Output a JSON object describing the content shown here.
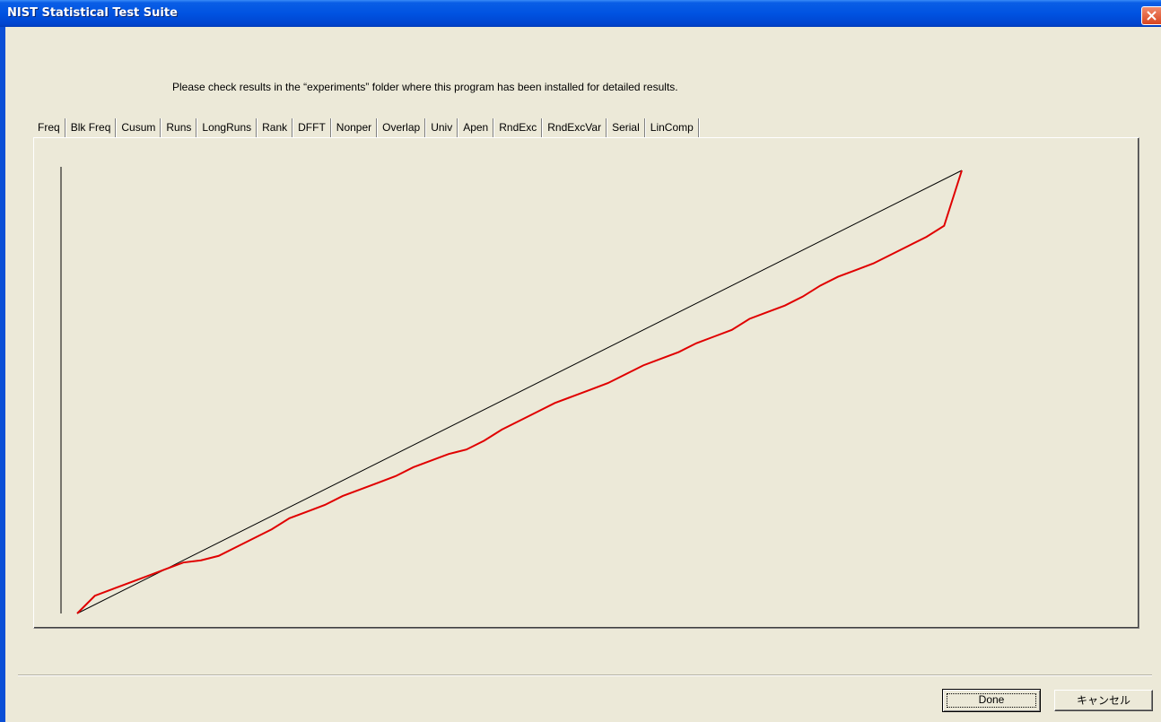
{
  "window": {
    "title": "NIST Statistical Test Suite"
  },
  "message": "Please check results in the “experiments” folder where this program has been installed for detailed results.",
  "tabs": [
    {
      "label": "Freq"
    },
    {
      "label": "Blk Freq"
    },
    {
      "label": "Cusum"
    },
    {
      "label": "Runs",
      "active": true
    },
    {
      "label": "LongRuns"
    },
    {
      "label": "Rank"
    },
    {
      "label": "DFFT"
    },
    {
      "label": "Nonper"
    },
    {
      "label": "Overlap"
    },
    {
      "label": "Univ"
    },
    {
      "label": "Apen"
    },
    {
      "label": "RndExc"
    },
    {
      "label": "RndExcVar"
    },
    {
      "label": "Serial"
    },
    {
      "label": "LinComp"
    }
  ],
  "buttons": {
    "done": "Done",
    "cancel": "キャンセル"
  },
  "colors": {
    "title_bar": "#0053e1",
    "dialog_bg": "#ece9d8",
    "reference_line": "#000000",
    "data_line": "#e00000"
  },
  "chart_data": {
    "type": "line",
    "title": "",
    "xlabel": "",
    "ylabel": "",
    "grid": false,
    "series": [
      {
        "values_role": "reference",
        "x": [
          0,
          1
        ],
        "y": [
          0,
          1
        ],
        "color": "#000000"
      },
      {
        "values_role": "observed",
        "x": [
          0,
          0.02,
          0.04,
          0.06,
          0.08,
          0.1,
          0.12,
          0.14,
          0.16,
          0.18,
          0.2,
          0.22,
          0.24,
          0.26,
          0.28,
          0.3,
          0.32,
          0.34,
          0.36,
          0.38,
          0.4,
          0.42,
          0.44,
          0.46,
          0.48,
          0.5,
          0.52,
          0.54,
          0.56,
          0.58,
          0.6,
          0.62,
          0.64,
          0.66,
          0.68,
          0.7,
          0.72,
          0.74,
          0.76,
          0.78,
          0.8,
          0.82,
          0.84,
          0.86,
          0.88,
          0.9,
          0.92,
          0.94,
          0.96,
          0.98,
          1
        ],
        "y": [
          0,
          0.04,
          0.055,
          0.07,
          0.085,
          0.1,
          0.115,
          0.12,
          0.13,
          0.15,
          0.17,
          0.19,
          0.215,
          0.23,
          0.245,
          0.265,
          0.28,
          0.295,
          0.31,
          0.33,
          0.345,
          0.36,
          0.37,
          0.39,
          0.415,
          0.435,
          0.455,
          0.475,
          0.49,
          0.505,
          0.52,
          0.54,
          0.56,
          0.575,
          0.59,
          0.61,
          0.625,
          0.64,
          0.665,
          0.68,
          0.695,
          0.715,
          0.74,
          0.76,
          0.775,
          0.79,
          0.81,
          0.83,
          0.85,
          0.875,
          1.0
        ],
        "color": "#e00000"
      }
    ]
  }
}
